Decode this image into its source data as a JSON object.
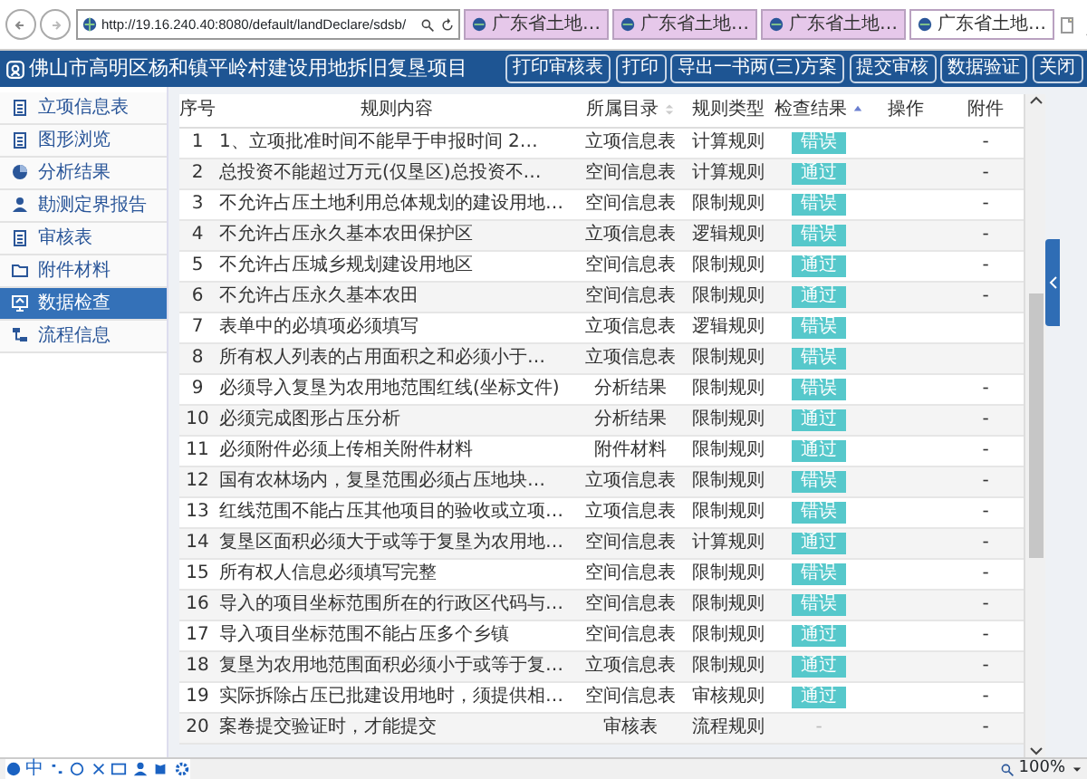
{
  "browser": {
    "address": "http://19.16.240.40:8080/default/landDeclare/sdsb/",
    "tabs": [
      {
        "title": "广东省土地…",
        "selected": false
      },
      {
        "title": "广东省土地…",
        "selected": false
      },
      {
        "title": "广东省土地…",
        "selected": false
      },
      {
        "title": "广东省土地…",
        "selected": true
      }
    ]
  },
  "app": {
    "title": "佛山市高明区杨和镇平岭村建设用地拆旧复垦项目",
    "buttons": [
      "打印审核表",
      "打印",
      "导出一书两(三)方案",
      "提交审核",
      "数据验证",
      "关闭"
    ]
  },
  "sidebar": {
    "items": [
      {
        "label": "立项信息表",
        "selected": false
      },
      {
        "label": "图形浏览",
        "selected": false
      },
      {
        "label": "分析结果",
        "selected": false
      },
      {
        "label": "勘测定界报告",
        "selected": false
      },
      {
        "label": "审核表",
        "selected": false
      },
      {
        "label": "附件材料",
        "selected": false
      },
      {
        "label": "数据检查",
        "selected": true
      },
      {
        "label": "流程信息",
        "selected": false
      }
    ]
  },
  "table": {
    "columns": [
      {
        "label": "序号",
        "sortable": false
      },
      {
        "label": "规则内容",
        "sortable": false
      },
      {
        "label": "所属目录",
        "sortable": true,
        "sorted_ascending": false
      },
      {
        "label": "规则类型",
        "sortable": false
      },
      {
        "label": "检查结果",
        "sortable": true,
        "sorted_ascending": true
      },
      {
        "label": "操作",
        "sortable": false
      },
      {
        "label": "附件",
        "sortable": false
      }
    ],
    "rows": [
      {
        "no": "1",
        "rule": "1、立项批准时间不能早于申报时间 2…",
        "catalog": "立项信息表",
        "type": "计算规则",
        "result": "错误",
        "badge": true,
        "attachment": "-"
      },
      {
        "no": "2",
        "rule": "总投资不能超过万元(仅垦区)总投资不…",
        "catalog": "空间信息表",
        "type": "计算规则",
        "result": "通过",
        "badge": true,
        "attachment": "-"
      },
      {
        "no": "3",
        "rule": "不允许占压土地利用总体规划的建设用地…",
        "catalog": "空间信息表",
        "type": "限制规则",
        "result": "错误",
        "badge": true,
        "attachment": "-"
      },
      {
        "no": "4",
        "rule": "不允许占压永久基本农田保护区",
        "catalog": "立项信息表",
        "type": "逻辑规则",
        "result": "错误",
        "badge": true,
        "attachment": "-"
      },
      {
        "no": "5",
        "rule": "不允许占压城乡规划建设用地区",
        "catalog": "空间信息表",
        "type": "限制规则",
        "result": "通过",
        "badge": true,
        "attachment": "-"
      },
      {
        "no": "6",
        "rule": "不允许占压永久基本农田",
        "catalog": "空间信息表",
        "type": "限制规则",
        "result": "通过",
        "badge": true,
        "attachment": "-"
      },
      {
        "no": "7",
        "rule": "表单中的必填项必须填写",
        "catalog": "立项信息表",
        "type": "逻辑规则",
        "result": "错误",
        "badge": true
      },
      {
        "no": "8",
        "rule": "所有权人列表的占用面积之和必须小于…",
        "catalog": "立项信息表",
        "type": "限制规则",
        "result": "错误",
        "badge": true
      },
      {
        "no": "9",
        "rule": "必须导入复垦为农用地范围红线(坐标文件)",
        "catalog": "分析结果",
        "type": "限制规则",
        "result": "错误",
        "badge": true,
        "attachment": "-"
      },
      {
        "no": "10",
        "rule": "必须完成图形占压分析",
        "catalog": "分析结果",
        "type": "限制规则",
        "result": "通过",
        "badge": true,
        "attachment": "-"
      },
      {
        "no": "11",
        "rule": "必须附件必须上传相关附件材料",
        "catalog": "附件材料",
        "type": "限制规则",
        "result": "通过",
        "badge": true,
        "attachment": "-"
      },
      {
        "no": "12",
        "rule": "国有农林场内，复垦范围必须占压地块…",
        "catalog": "立项信息表",
        "type": "限制规则",
        "result": "错误",
        "badge": true,
        "attachment": "-"
      },
      {
        "no": "13",
        "rule": "红线范围不能占压其他项目的验收或立项…",
        "catalog": "立项信息表",
        "type": "限制规则",
        "result": "错误",
        "badge": true,
        "attachment": "-"
      },
      {
        "no": "14",
        "rule": "复垦区面积必须大于或等于复垦为农用地…",
        "catalog": "空间信息表",
        "type": "计算规则",
        "result": "通过",
        "badge": true,
        "attachment": "-"
      },
      {
        "no": "15",
        "rule": "所有权人信息必须填写完整",
        "catalog": "空间信息表",
        "type": "限制规则",
        "result": "错误",
        "badge": true,
        "attachment": "-"
      },
      {
        "no": "16",
        "rule": "导入的项目坐标范围所在的行政区代码与…",
        "catalog": "空间信息表",
        "type": "限制规则",
        "result": "错误",
        "badge": true,
        "attachment": "-"
      },
      {
        "no": "17",
        "rule": "导入项目坐标范围不能占压多个乡镇",
        "catalog": "空间信息表",
        "type": "限制规则",
        "result": "通过",
        "badge": true,
        "attachment": "-"
      },
      {
        "no": "18",
        "rule": "复垦为农用地范围面积必须小于或等于复…",
        "catalog": "立项信息表",
        "type": "限制规则",
        "result": "通过",
        "badge": true,
        "attachment": "-"
      },
      {
        "no": "19",
        "rule": "实际拆除占压已批建设用地时，须提供相…",
        "catalog": "空间信息表",
        "type": "审核规则",
        "result": "通过",
        "badge": true,
        "attachment": "-"
      },
      {
        "no": "20",
        "rule": "案卷提交验证时，才能提交",
        "catalog": "审核表",
        "type": "流程规则",
        "result": "-",
        "badge": false,
        "attachment": "-"
      }
    ]
  },
  "ime": {
    "mode": "中"
  },
  "status_bar": {
    "zoom": "100%"
  }
}
